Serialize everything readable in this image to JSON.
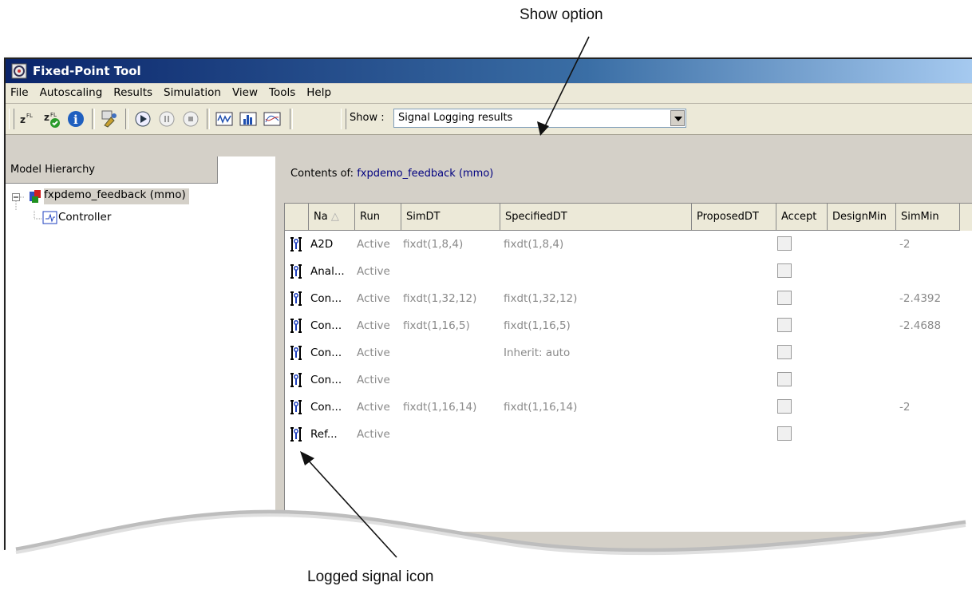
{
  "callouts": {
    "show_option": "Show option",
    "logged_signal_icon": "Logged signal icon"
  },
  "window": {
    "title": "Fixed-Point Tool"
  },
  "menu": [
    "File",
    "Autoscaling",
    "Results",
    "Simulation",
    "View",
    "Tools",
    "Help"
  ],
  "toolbar": {
    "show_label": "Show :",
    "show_value": "Signal Logging results"
  },
  "model_hierarchy": {
    "header": "Model Hierarchy",
    "root": "fxpdemo_feedback (mmo)",
    "child": "Controller"
  },
  "contents": {
    "label": "Contents of:",
    "model": "fxpdemo_feedback (mmo)"
  },
  "table": {
    "columns": [
      "Na",
      "Run",
      "SimDT",
      "SpecifiedDT",
      "ProposedDT",
      "Accept",
      "DesignMin",
      "SimMin"
    ],
    "rows": [
      {
        "name": "A2D",
        "run": "Active",
        "simdt": "fixdt(1,8,4)",
        "specdt": "fixdt(1,8,4)",
        "simmin": "-2"
      },
      {
        "name": "Anal...",
        "run": "Active",
        "simdt": "",
        "specdt": "",
        "simmin": ""
      },
      {
        "name": "Con...",
        "run": "Active",
        "simdt": "fixdt(1,32,12)",
        "specdt": "fixdt(1,32,12)",
        "simmin": "-2.4392"
      },
      {
        "name": "Con...",
        "run": "Active",
        "simdt": "fixdt(1,16,5)",
        "specdt": "fixdt(1,16,5)",
        "simmin": "-2.4688"
      },
      {
        "name": "Con...",
        "run": "Active",
        "simdt": "",
        "specdt": "Inherit: auto",
        "simmin": ""
      },
      {
        "name": "Con...",
        "run": "Active",
        "simdt": "",
        "specdt": "",
        "simmin": ""
      },
      {
        "name": "Con...",
        "run": "Active",
        "simdt": "fixdt(1,16,14)",
        "specdt": "fixdt(1,16,14)",
        "simmin": "-2"
      },
      {
        "name": "Ref...",
        "run": "Active",
        "simdt": "",
        "specdt": "",
        "simmin": ""
      }
    ]
  },
  "icons": [
    "app-icon",
    "autoscale-icon",
    "apply-icon",
    "info-icon",
    "tool-icon",
    "play-icon",
    "pause-icon",
    "stop-icon",
    "plot-icon",
    "histogram-icon",
    "compare-icon",
    "logged-signal-icon"
  ],
  "colors": {
    "titlebar": "#0a246a",
    "model_link": "#000080",
    "inactive_text": "#8a8a8a"
  }
}
